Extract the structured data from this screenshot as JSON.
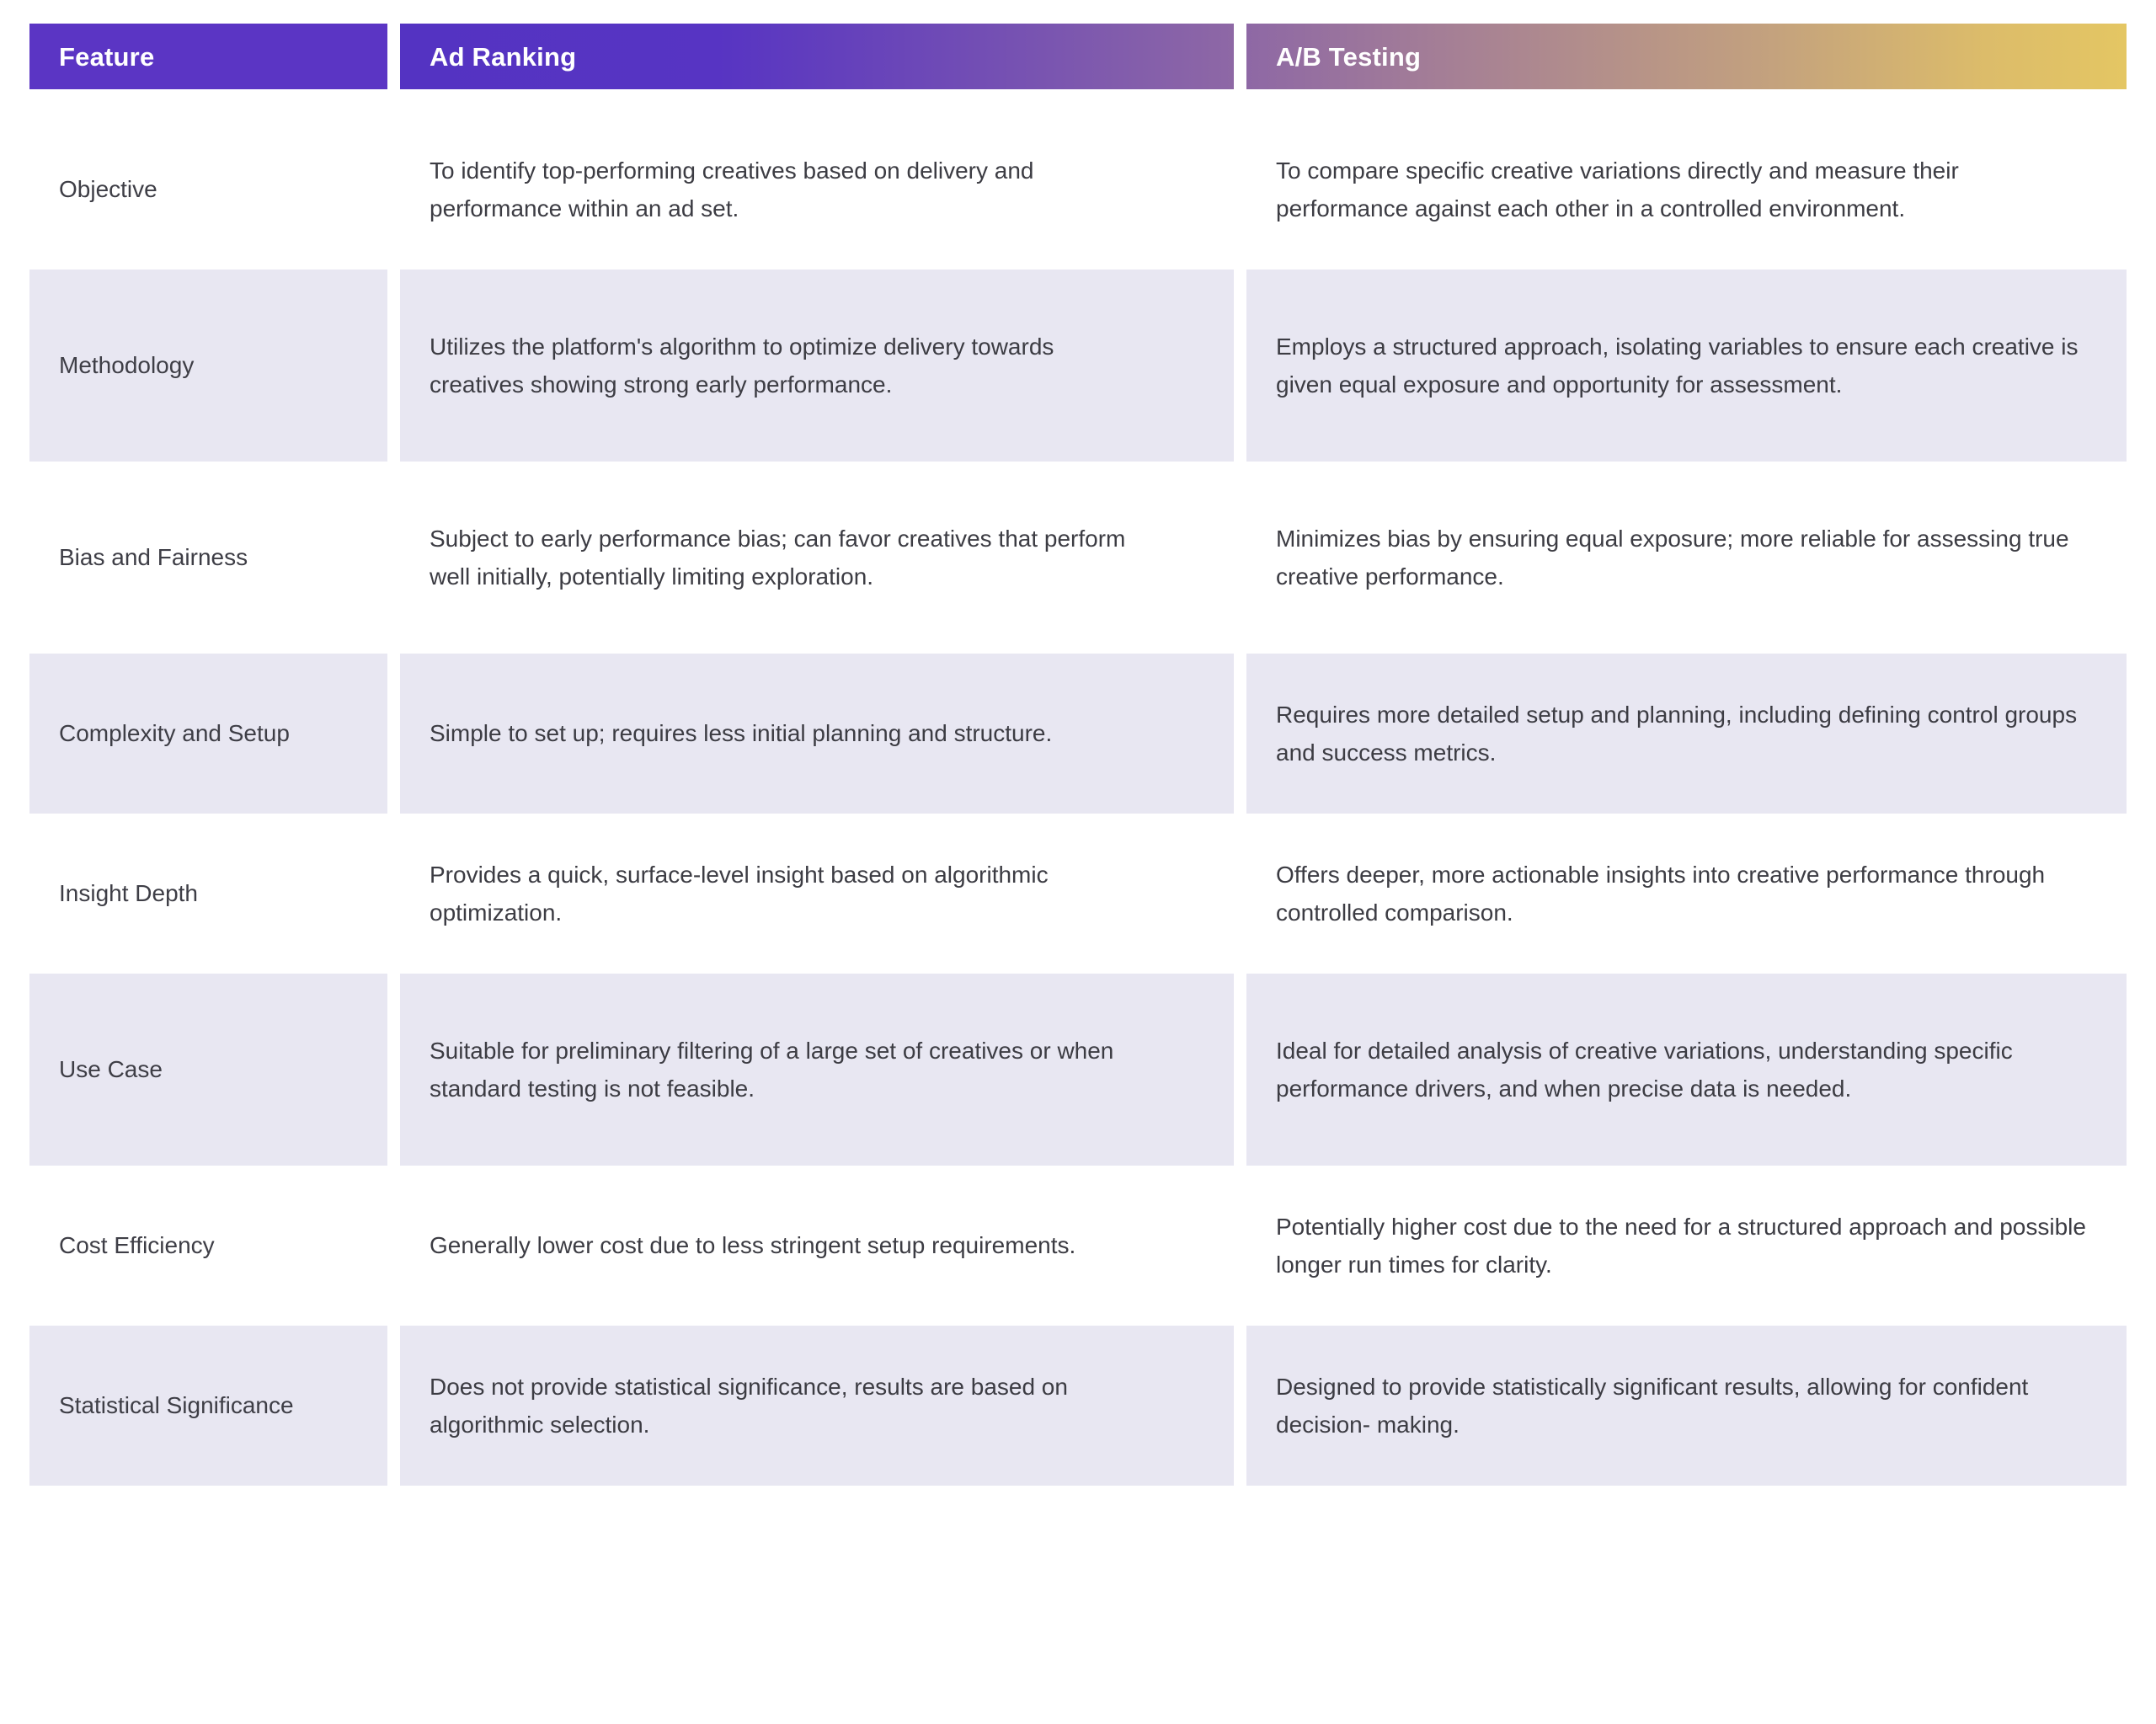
{
  "table": {
    "columns": [
      {
        "key": "feature",
        "label": "Feature",
        "style": "solid-purple"
      },
      {
        "key": "ad_ranking",
        "label": "Ad Ranking",
        "style": "gradient-purple-mauve"
      },
      {
        "key": "ab_testing",
        "label": "A/B Testing",
        "style": "gradient-mauve-gold"
      }
    ],
    "colors": {
      "header_feature": "#5b35c4",
      "header_ad_ranking_start": "#5433c2",
      "header_ad_ranking_end": "#8e68a5",
      "header_ab_testing_start": "#8e68a5",
      "header_ab_testing_end": "#e4c663",
      "header_text": "#ffffff",
      "row_shaded_background": "#e8e7f2",
      "row_plain_background": "#ffffff",
      "body_text": "#3c3c43",
      "page_background": "#ffffff"
    },
    "rows": [
      {
        "feature": "Objective",
        "ad_ranking": "To identify top-performing creatives based on delivery and performance within an ad set.",
        "ab_testing": "To compare specific creative variations directly and measure their performance against each other in a controlled environment.",
        "shaded": false
      },
      {
        "feature": "Methodology",
        "ad_ranking": "Utilizes the platform's algorithm to optimize delivery towards creatives showing strong early performance.",
        "ab_testing": "Employs a structured approach, isolating variables to ensure each creative is given equal exposure and opportunity for assessment.",
        "shaded": true
      },
      {
        "feature": "Bias and Fairness",
        "ad_ranking": "Subject to early performance bias; can favor creatives that perform well initially, potentially limiting exploration.",
        "ab_testing": "Minimizes bias by ensuring equal exposure; more reliable for assessing true creative performance.",
        "shaded": false
      },
      {
        "feature": "Complexity and Setup",
        "ad_ranking": "Simple to set up; requires less initial planning and structure.",
        "ab_testing": "Requires more detailed setup and planning, including defining control groups and success metrics.",
        "shaded": true
      },
      {
        "feature": "Insight Depth",
        "ad_ranking": "Provides a quick, surface-level insight based on algorithmic optimization.",
        "ab_testing": "Offers deeper, more actionable insights into creative performance through controlled comparison.",
        "shaded": false
      },
      {
        "feature": "Use Case",
        "ad_ranking": "Suitable for preliminary filtering of a large set of creatives or when standard testing is not feasible.",
        "ab_testing": "Ideal for detailed analysis of creative variations, understanding specific performance drivers, and when precise data is needed.",
        "shaded": true
      },
      {
        "feature": "Cost Efficiency",
        "ad_ranking": "Generally lower cost due to less stringent setup requirements.",
        "ab_testing": "Potentially higher cost due to the need for a structured approach and possible longer run times for clarity.",
        "shaded": false
      },
      {
        "feature": "Statistical Significance",
        "ad_ranking": "Does not provide statistical significance, results are based on algorithmic selection.",
        "ab_testing": "Designed to provide statistically significant results, allowing for confident decision- making.",
        "shaded": true
      }
    ]
  }
}
